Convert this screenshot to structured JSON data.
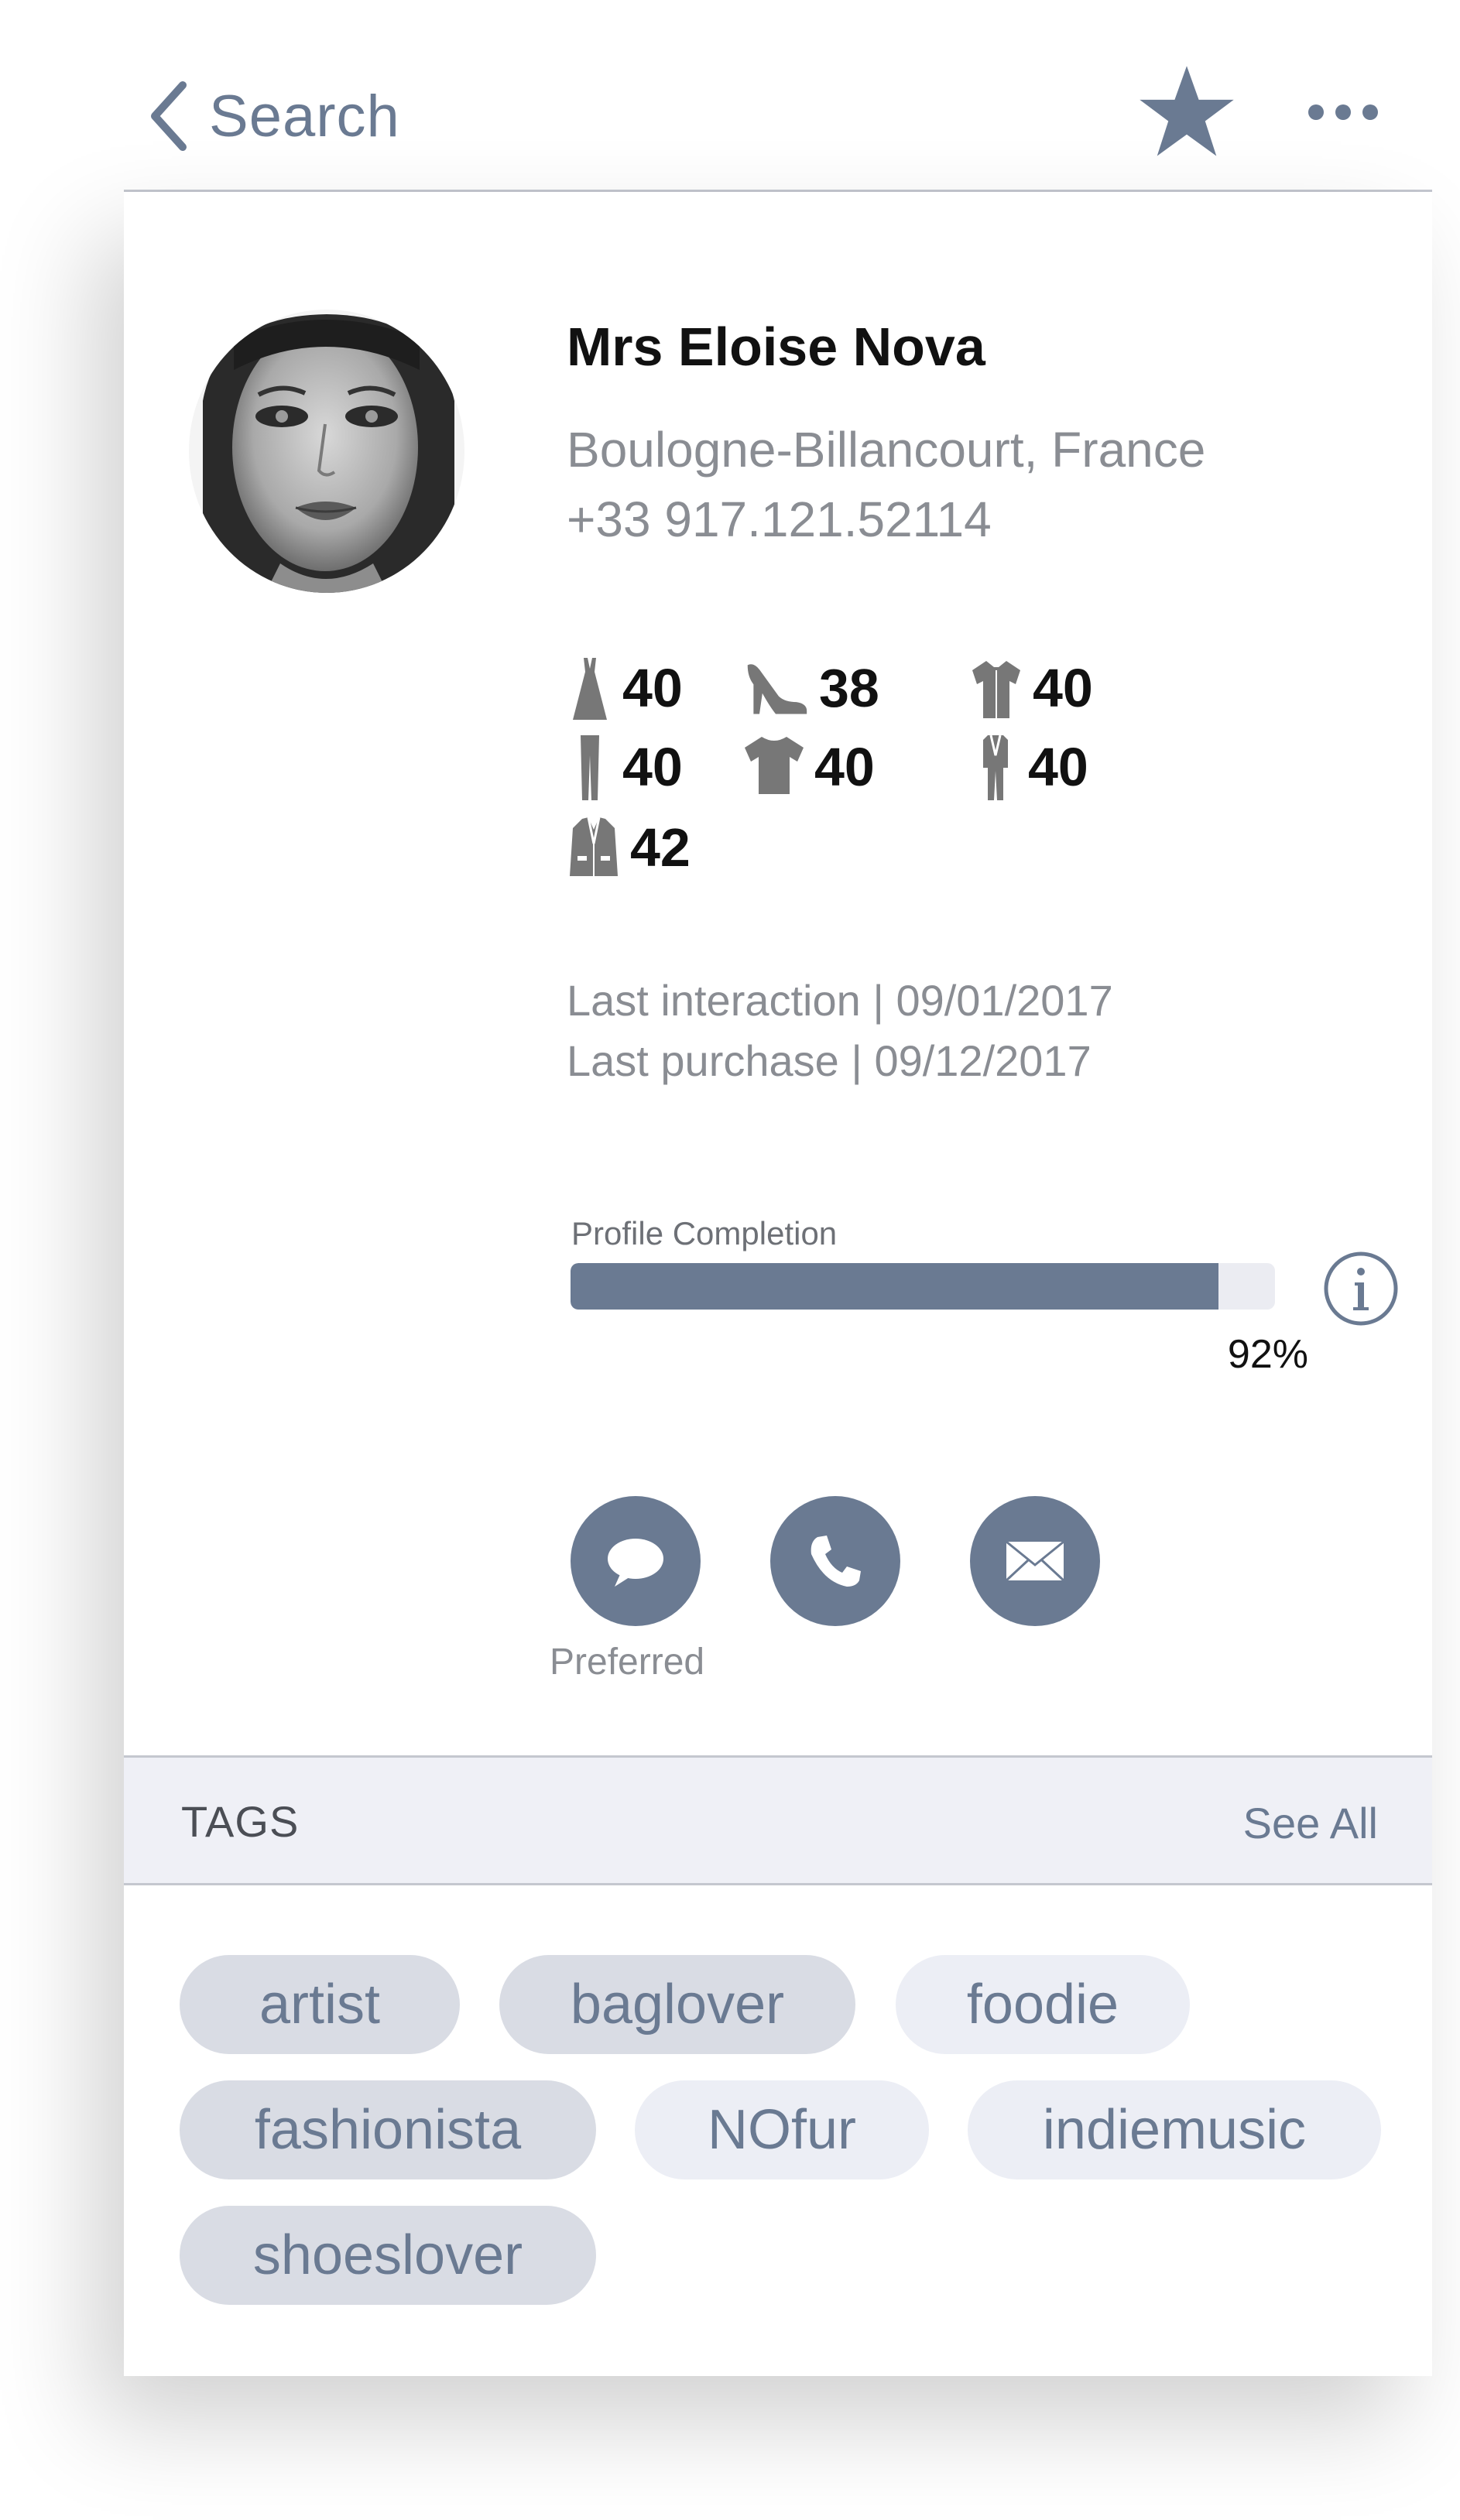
{
  "nav": {
    "back_label": "Search",
    "favorite_icon": "star-icon",
    "more_icon": "ellipsis-icon"
  },
  "profile": {
    "name": "Mrs Eloise Nova",
    "address": "Boulogne-Billancourt, France",
    "phone": "+33 917.121.52114",
    "sizes": [
      {
        "icon": "dress-icon",
        "value": "40"
      },
      {
        "icon": "heel-shoe-icon",
        "value": "38"
      },
      {
        "icon": "shirt-icon",
        "value": "40"
      },
      {
        "icon": "pants-icon",
        "value": "40"
      },
      {
        "icon": "tshirt-icon",
        "value": "40"
      },
      {
        "icon": "suit-icon",
        "value": "40"
      },
      {
        "icon": "jacket-icon",
        "value": "42"
      }
    ],
    "last_interaction": "Last interaction | 09/01/2017",
    "last_purchase": "Last purchase | 09/12/2017"
  },
  "completion": {
    "label": "Profile Completion",
    "percent": 92,
    "percent_label": "92%"
  },
  "contact": {
    "buttons": [
      {
        "icon": "chat-bubble-icon"
      },
      {
        "icon": "phone-icon"
      },
      {
        "icon": "mail-icon"
      }
    ],
    "preferred_label": "Preferred"
  },
  "tags": {
    "title": "TAGS",
    "see_all": "See All",
    "items": [
      {
        "label": "artist",
        "selected": true
      },
      {
        "label": "baglover",
        "selected": true
      },
      {
        "label": "foodie",
        "selected": false
      },
      {
        "label": "fashionista",
        "selected": true
      },
      {
        "label": "NOfur",
        "selected": false
      },
      {
        "label": "indiemusic",
        "selected": false
      },
      {
        "label": "shoeslover",
        "selected": true
      }
    ]
  },
  "colors": {
    "accent": "#6a7a92",
    "muted_text": "#8a8d93",
    "tag_selected": "#d9dce4",
    "tag_unselected": "#eceef5",
    "section_bg": "#eff0f6"
  }
}
